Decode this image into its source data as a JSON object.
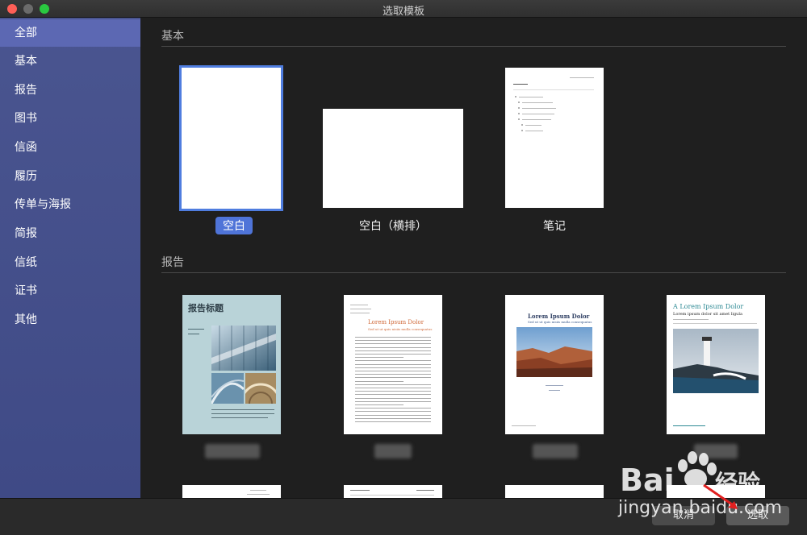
{
  "window": {
    "title": "选取模板"
  },
  "sidebar": {
    "items": [
      {
        "label": "全部",
        "active": true
      },
      {
        "label": "基本",
        "active": false
      },
      {
        "label": "报告",
        "active": false
      },
      {
        "label": "图书",
        "active": false
      },
      {
        "label": "信函",
        "active": false
      },
      {
        "label": "履历",
        "active": false
      },
      {
        "label": "传单与海报",
        "active": false
      },
      {
        "label": "简报",
        "active": false
      },
      {
        "label": "信纸",
        "active": false
      },
      {
        "label": "证书",
        "active": false
      },
      {
        "label": "其他",
        "active": false
      }
    ]
  },
  "sections": {
    "basic": {
      "title": "基本",
      "templates": [
        {
          "name": "空白",
          "selected": true
        },
        {
          "name": "空白（横排）",
          "selected": false
        },
        {
          "name": "笔记",
          "selected": false
        }
      ]
    },
    "report": {
      "title": "报告",
      "templates": [
        {
          "thumb_title": "报告标题"
        },
        {
          "thumb_title": "Lorem Ipsum Dolor",
          "thumb_subtitle": "Sed ut ut quis nisiis mulla consequatus"
        },
        {
          "thumb_title": "Lorem Ipsum Dolor",
          "thumb_subtitle": "Sed ut ut quis nisiis mulla consequatus"
        },
        {
          "thumb_title": "A Lorem Ipsum Dolor",
          "thumb_subtitle": "Lorem ipsum dolor sit amet ligula"
        }
      ]
    }
  },
  "footer": {
    "cancel_label": "取消",
    "choose_label": "选取"
  },
  "watermark": {
    "brand": "Bai",
    "brand_cn": "经验",
    "url": "jingyan.baidu.com"
  },
  "colors": {
    "sidebar": "#46518c",
    "accent": "#4f74d8",
    "selected_outline": "#4f7ddf"
  }
}
